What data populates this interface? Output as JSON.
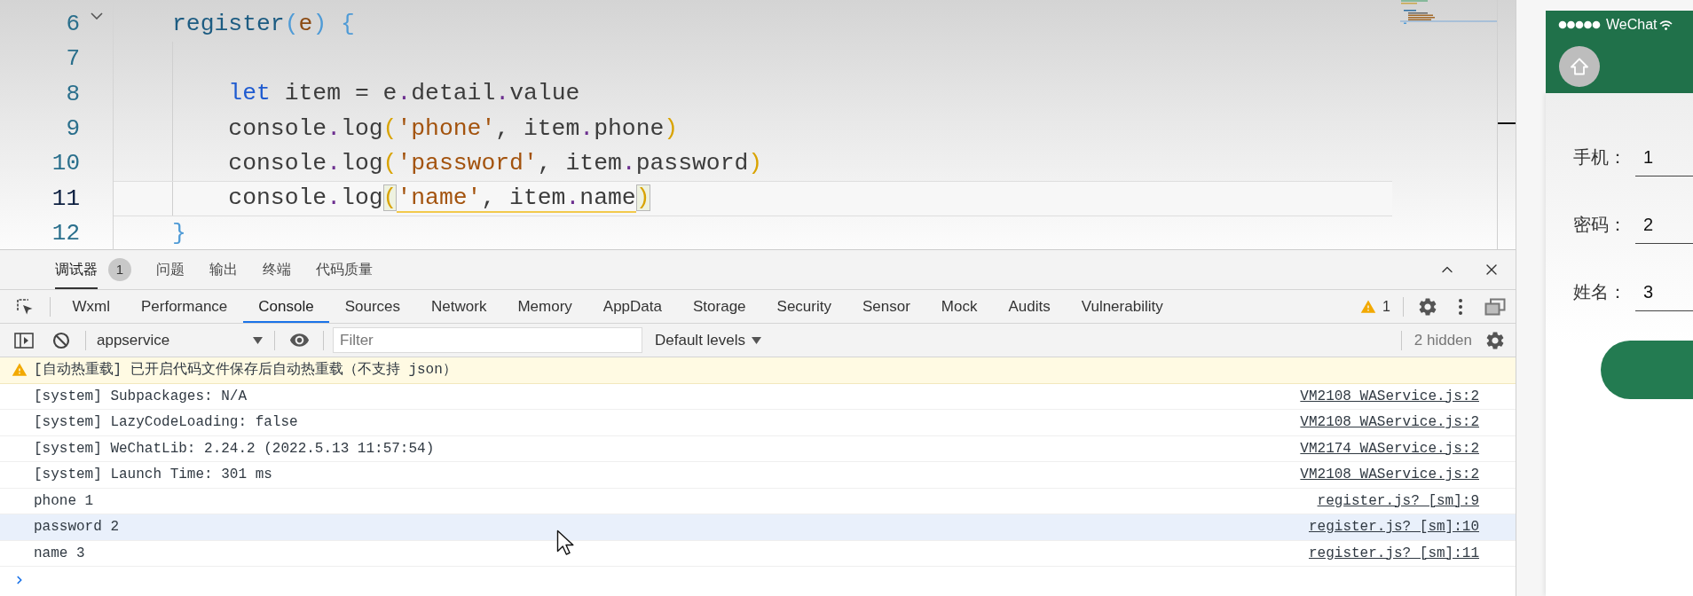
{
  "editor": {
    "lines": [
      {
        "number": "6",
        "foldable": true,
        "current": false,
        "tokens": [
          {
            "text": "register",
            "kind": "function"
          },
          {
            "text": "(",
            "kind": "paren"
          },
          {
            "text": "e",
            "kind": "param"
          },
          {
            "text": ") {",
            "kind": "paren"
          }
        ],
        "children": [
          {
            "number": "7",
            "foldable": false,
            "current": false
          },
          {
            "number": "8",
            "foldable": false,
            "current": false,
            "tokens": [
              {
                "text": "let",
                "kind": "keyword"
              },
              {
                "text": " item = e",
                "kind": "plain"
              },
              {
                "text": ".",
                "kind": "dot"
              },
              {
                "text": "detail",
                "kind": "plain"
              },
              {
                "text": ".",
                "kind": "dot"
              },
              {
                "text": "value",
                "kind": "plain"
              }
            ]
          },
          {
            "number": "9",
            "foldable": false,
            "current": false,
            "tokens": [
              {
                "text": "console",
                "kind": "plain"
              },
              {
                "text": ".",
                "kind": "dot"
              },
              {
                "text": "log",
                "kind": "plain"
              },
              {
                "text": "(",
                "kind": "bracket",
                "matched": false
              },
              {
                "text": "'phone'",
                "kind": "string"
              },
              {
                "text": ", item",
                "kind": "plain"
              },
              {
                "text": ".",
                "kind": "dot"
              },
              {
                "text": "phone",
                "kind": "plain"
              },
              {
                "text": ")",
                "kind": "bracket",
                "matched": false
              }
            ]
          },
          {
            "number": "10",
            "foldable": false,
            "current": false,
            "tokens": [
              {
                "text": "console",
                "kind": "plain"
              },
              {
                "text": ".",
                "kind": "dot"
              },
              {
                "text": "log",
                "kind": "plain"
              },
              {
                "text": "(",
                "kind": "bracket",
                "matched": false
              },
              {
                "text": "'password'",
                "kind": "string"
              },
              {
                "text": ", item",
                "kind": "plain"
              },
              {
                "text": ".",
                "kind": "dot"
              },
              {
                "text": "password",
                "kind": "plain"
              },
              {
                "text": ")",
                "kind": "bracket",
                "matched": false
              }
            ]
          },
          {
            "number": "11",
            "foldable": false,
            "current": true,
            "tokens": [
              {
                "text": "console",
                "kind": "plain"
              },
              {
                "text": ".",
                "kind": "dot"
              },
              {
                "text": "log",
                "kind": "plain"
              },
              {
                "text": "(",
                "kind": "bracket",
                "matched": true
              },
              {
                "text": "'name'",
                "kind": "string"
              },
              {
                "text": ", item",
                "kind": "plain"
              },
              {
                "text": ".",
                "kind": "dot"
              },
              {
                "text": "name",
                "kind": "plain"
              },
              {
                "text": ")",
                "kind": "bracket",
                "matched": true
              }
            ]
          }
        ]
      },
      {
        "number": "12",
        "foldable": false,
        "current": false,
        "tokens": [
          {
            "text": "}",
            "kind": "paren"
          }
        ]
      }
    ]
  },
  "devtools": {
    "panel_tabs": [
      {
        "label": "调试器",
        "badge": "1",
        "selected": true
      },
      {
        "label": "问题",
        "selected": false
      },
      {
        "label": "输出",
        "selected": false
      },
      {
        "label": "终端",
        "selected": false
      },
      {
        "label": "代码质量",
        "selected": false
      }
    ],
    "tabs": [
      {
        "label": "Wxml",
        "selected": false
      },
      {
        "label": "Performance",
        "selected": false
      },
      {
        "label": "Console",
        "selected": true
      },
      {
        "label": "Sources",
        "selected": false
      },
      {
        "label": "Network",
        "selected": false
      },
      {
        "label": "Memory",
        "selected": false
      },
      {
        "label": "AppData",
        "selected": false
      },
      {
        "label": "Storage",
        "selected": false
      },
      {
        "label": "Security",
        "selected": false
      },
      {
        "label": "Sensor",
        "selected": false
      },
      {
        "label": "Mock",
        "selected": false
      },
      {
        "label": "Audits",
        "selected": false
      },
      {
        "label": "Vulnerability",
        "selected": false
      }
    ],
    "warning_count": "1",
    "context": "appservice",
    "filter": {
      "placeholder": "Filter"
    },
    "levels": "Default levels",
    "hidden": "2 hidden",
    "messages": [
      {
        "kind": "warning",
        "text": "[自动热重载] 已开启代码文件保存后自动热重载（不支持 json）",
        "highlighted": false
      },
      {
        "kind": "log",
        "text": "[system] Subpackages: N/A",
        "source": "VM2108 WAService.js:2",
        "highlighted": false
      },
      {
        "kind": "log",
        "text": "[system] LazyCodeLoading: false",
        "source": "VM2108 WAService.js:2",
        "highlighted": false
      },
      {
        "kind": "log",
        "text": "[system] WeChatLib: 2.24.2 (2022.5.13 11:57:54)",
        "source": "VM2174 WAService.js:2",
        "highlighted": false
      },
      {
        "kind": "log",
        "text": "[system] Launch Time: 301 ms",
        "source": "VM2108 WAService.js:2",
        "highlighted": false
      },
      {
        "kind": "log",
        "text": "phone 1",
        "source": "register.js? [sm]:9",
        "highlighted": false
      },
      {
        "kind": "log",
        "text": "password 2",
        "source": "register.js? [sm]:10",
        "highlighted": true
      },
      {
        "kind": "log",
        "text": "name 3",
        "source": "register.js? [sm]:11",
        "highlighted": false
      }
    ]
  },
  "simulator": {
    "carrier": "WeChat",
    "fields": [
      {
        "label": "手机：",
        "value": "1"
      },
      {
        "label": "密码：",
        "value": "2"
      },
      {
        "label": "姓名：",
        "value": "3"
      }
    ]
  }
}
